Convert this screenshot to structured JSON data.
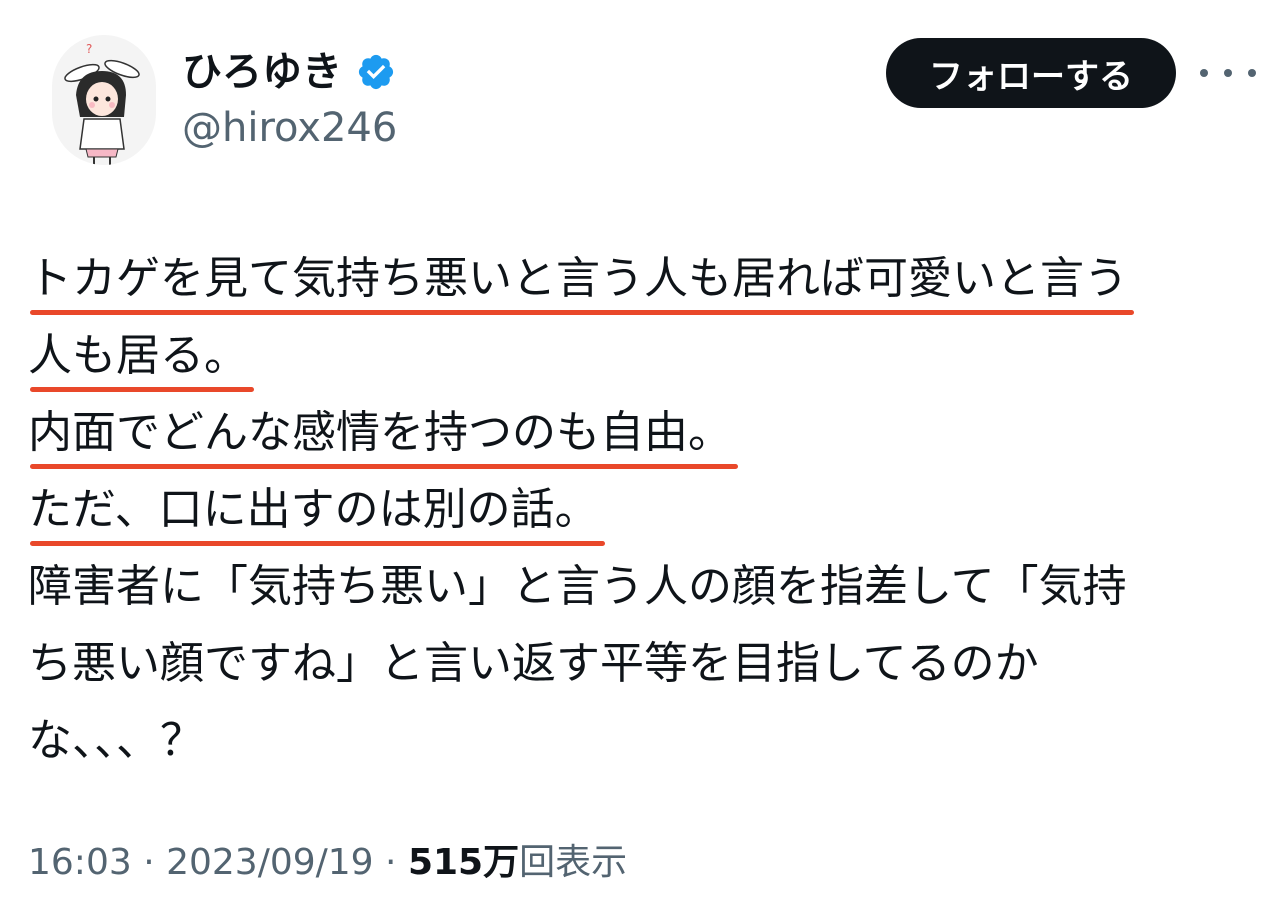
{
  "user": {
    "display_name": "ひろゆき",
    "handle": "@hirox246",
    "verified_icon": "verified-badge-icon",
    "avatar": "avatar-illustration"
  },
  "follow_label": "フォローする",
  "more_icon": "more-options-icon",
  "tweet": {
    "lines": [
      {
        "text": "トカゲを見て気持ち悪いと言う人も居れば可愛いと言う",
        "underlined": true
      },
      {
        "text": "人も居る。",
        "underlined": true
      },
      {
        "text": "内面でどんな感情を持つのも自由。",
        "underlined": true
      },
      {
        "text": "ただ、口に出すのは別の話。",
        "underlined": true
      },
      {
        "text": "障害者に「気持ち悪い」と言う人の顔を指差して「気持",
        "underlined": false
      },
      {
        "text": "ち悪い顔ですね」と言い返す平等を目指してるのか",
        "underlined": false
      },
      {
        "text": "な、、、？",
        "underlined": false
      }
    ]
  },
  "meta": {
    "time": "16:03",
    "sep1": " · ",
    "date": "2023/09/19",
    "sep2": " · ",
    "views_count": "515万",
    "views_label": "回表示"
  },
  "colors": {
    "underline": "#e9482a",
    "verified": "#1d9bf0",
    "follow_bg": "#0f1419",
    "secondary_text": "#536471"
  }
}
